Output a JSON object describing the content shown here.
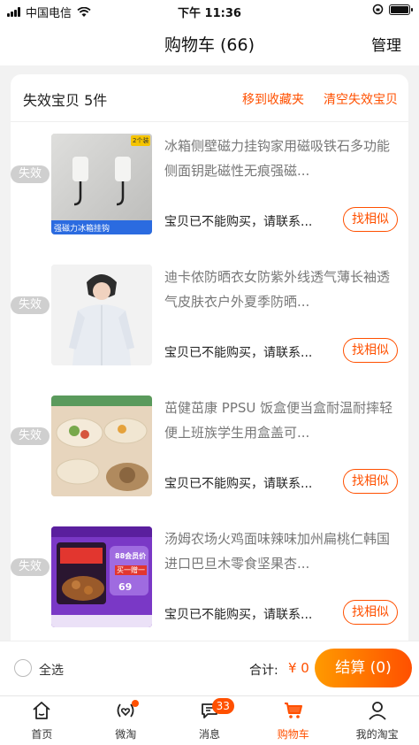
{
  "status_bar": {
    "carrier": "中国电信",
    "time": "下午 11:36",
    "battery_level": 0.9
  },
  "header": {
    "title": "购物车 (66)",
    "manage_label": "管理"
  },
  "invalid_section": {
    "title": "失效宝贝 5件",
    "move_to_favorites": "移到收藏夹",
    "clear_invalid": "清空失效宝贝"
  },
  "items": [
    {
      "tag": "失效",
      "title": "冰箱侧壁磁力挂钩家用磁吸铁石多功能侧面钥匙磁性无痕强磁...",
      "status": "宝贝已不能购买，请联系...",
      "find_similar": "找相似",
      "thumb_caption": "强磁力冰箱挂钩",
      "thumb_badge": "2个装"
    },
    {
      "tag": "失效",
      "title": "迪卡侬防晒衣女防紫外线透气薄长袖透气皮肤衣户外夏季防晒...",
      "status": "宝贝已不能购买，请联系...",
      "find_similar": "找相似"
    },
    {
      "tag": "失效",
      "title": "茁健茁康 PPSU 饭盒便当盒耐温耐摔轻便上班族学生用盒盖可...",
      "status": "宝贝已不能购买，请联系...",
      "find_similar": "找相似"
    },
    {
      "tag": "失效",
      "title": "汤姆农场火鸡面味辣味加州扁桃仁韩国进口巴旦木零食坚果杏...",
      "status": "宝贝已不能购买，请联系...",
      "find_similar": "找相似",
      "thumb_price": "69",
      "thumb_promo": "88会员价",
      "thumb_promo2": "买一赠一"
    }
  ],
  "checkout": {
    "select_all": "全选",
    "total_label": "合计:",
    "total_amount": "¥ 0",
    "button": "结算 (0)"
  },
  "tabs": [
    {
      "label": "首页",
      "icon": "home-icon"
    },
    {
      "label": "微淘",
      "icon": "weitao-icon"
    },
    {
      "label": "消息",
      "icon": "message-icon",
      "badge": "33"
    },
    {
      "label": "购物车",
      "icon": "cart-icon",
      "active": true
    },
    {
      "label": "我的淘宝",
      "icon": "profile-icon"
    }
  ],
  "colors": {
    "accent": "#ff5000",
    "gradient_start": "#ff9a00",
    "invalid_tag": "#cfcfcf"
  }
}
